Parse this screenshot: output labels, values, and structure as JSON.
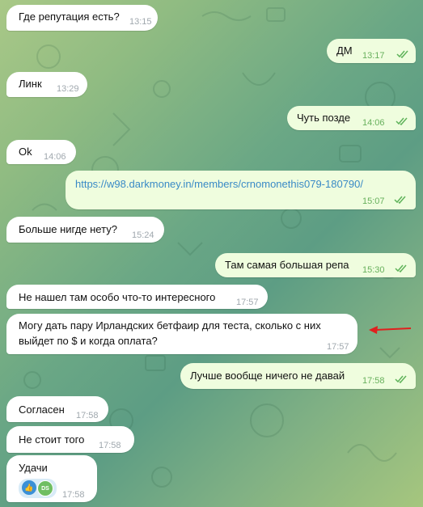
{
  "messages": [
    {
      "id": "m1",
      "dir": "in",
      "text": "Где репутация есть?",
      "time": "13:15"
    },
    {
      "id": "m2",
      "dir": "out",
      "text": "ДМ",
      "time": "13:17"
    },
    {
      "id": "m3",
      "dir": "in",
      "text": "Линк",
      "time": "13:29"
    },
    {
      "id": "m4",
      "dir": "out",
      "text": "Чуть позде",
      "time": "14:06"
    },
    {
      "id": "m5",
      "dir": "in",
      "text": "Ok",
      "time": "14:06"
    },
    {
      "id": "m6",
      "dir": "out",
      "text": "https://w98.darkmoney.in/members/crnomonethis079-180790/",
      "time": "15:07"
    },
    {
      "id": "m7",
      "dir": "in",
      "text": "Больше нигде нету?",
      "time": "15:24"
    },
    {
      "id": "m8",
      "dir": "out",
      "text": "Там самая большая репа",
      "time": "15:30"
    },
    {
      "id": "m9",
      "dir": "in",
      "text": "Не нашел там особо что-то интересного",
      "time": "17:57"
    },
    {
      "id": "m10",
      "dir": "in",
      "text_line1": "Могу дать пару Ирландских бетфаир для теста, сколько с них",
      "text_line2": "выйдет по $ и когда оплата?",
      "time": "17:57"
    },
    {
      "id": "m11",
      "dir": "out",
      "text": "Лучше вообще ничего не давай",
      "time": "17:58"
    },
    {
      "id": "m12",
      "dir": "in",
      "text": "Согласен",
      "time": "17:58"
    },
    {
      "id": "m13",
      "dir": "in",
      "text": "Не стоит того",
      "time": "17:58"
    },
    {
      "id": "m14",
      "dir": "in",
      "text": "Удачи",
      "time": "17:58",
      "reaction_emoji": "👍",
      "reaction_avatar": "DS"
    }
  ],
  "colors": {
    "incoming": "#ffffff",
    "outgoing": "#effdde",
    "link": "#3a8ac6",
    "annotation_arrow": "#e0201e"
  }
}
